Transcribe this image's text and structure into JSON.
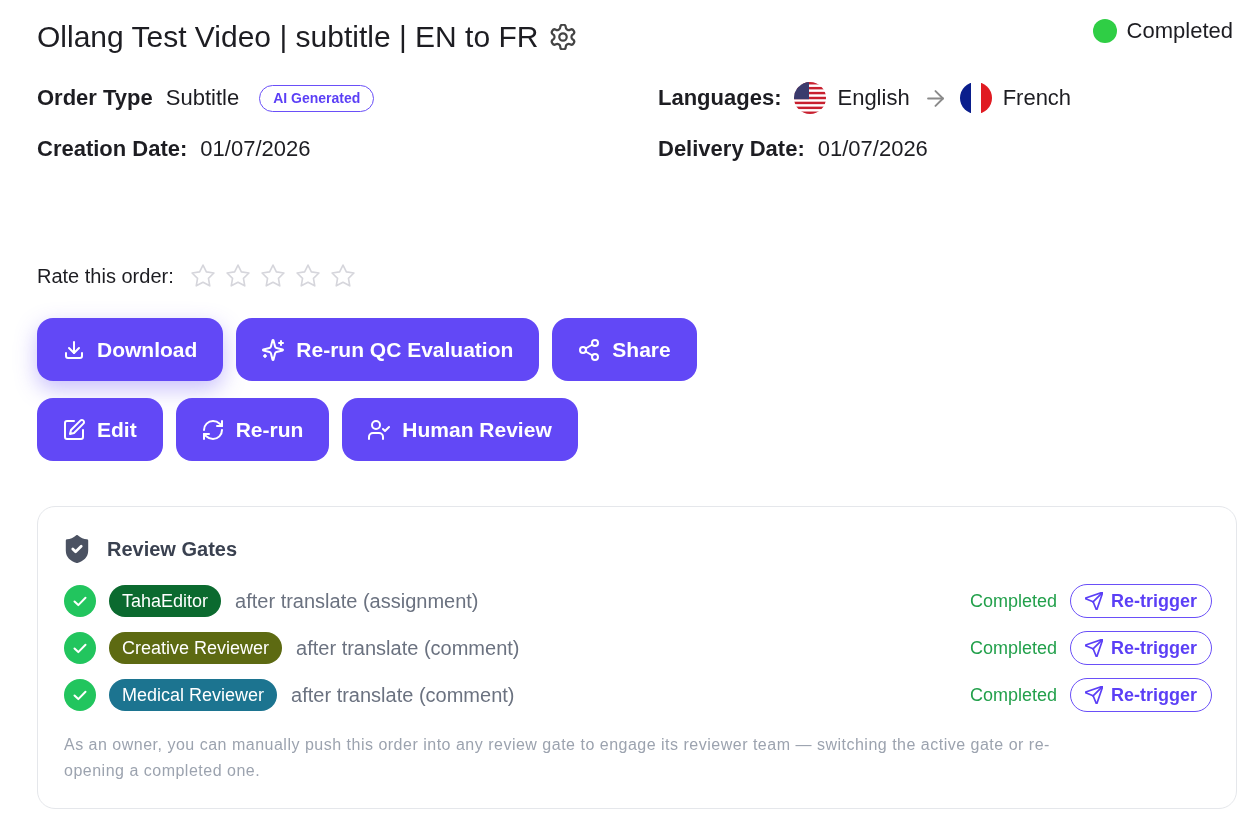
{
  "header": {
    "title": "Ollang Test Video | subtitle | EN to FR",
    "status": "Completed"
  },
  "details": [
    {
      "kind": "order_type",
      "label": "Order Type",
      "value": "Subtitle",
      "badge": "AI Generated"
    },
    {
      "kind": "languages",
      "label": "Languages:",
      "languages": [
        {
          "kind": "us",
          "name": "English"
        },
        {
          "kind": "fr",
          "name": "French"
        }
      ]
    },
    {
      "kind": "date",
      "label": "Creation Date:",
      "value": "01/07/2026"
    },
    {
      "kind": "date",
      "label": "Delivery Date:",
      "value": "01/07/2026"
    }
  ],
  "rating": {
    "label": "Rate this order:",
    "stars": 0
  },
  "actions": [
    {
      "buttons": [
        {
          "kind": "download",
          "label": "Download",
          "highlighted": true
        },
        {
          "kind": "sparkles",
          "label": "Re-run QC Evaluation",
          "highlighted": false
        },
        {
          "kind": "share",
          "label": "Share",
          "highlighted": false
        }
      ]
    },
    {
      "buttons": [
        {
          "kind": "edit",
          "label": "Edit",
          "highlighted": false
        },
        {
          "kind": "rerun",
          "label": "Re-run",
          "highlighted": false
        },
        {
          "kind": "human_review",
          "label": "Human Review",
          "highlighted": false
        }
      ]
    }
  ],
  "review_gates": {
    "title": "Review Gates",
    "gates": [
      {
        "done": true,
        "team": "TahaEditor",
        "color": "#0b6a2f",
        "stage": "after translate (assignment)",
        "status": "Completed",
        "action": "Re-trigger"
      },
      {
        "done": true,
        "team": "Creative Reviewer",
        "color": "#5d6a12",
        "stage": "after translate (comment)",
        "status": "Completed",
        "action": "Re-trigger"
      },
      {
        "done": true,
        "team": "Medical Reviewer",
        "color": "#1c7490",
        "stage": "after translate (comment)",
        "status": "Completed",
        "action": "Re-trigger"
      }
    ],
    "note": "As an owner, you can manually push this order into any review gate to engage its reviewer team — switching the active gate or re-opening a completed one."
  }
}
